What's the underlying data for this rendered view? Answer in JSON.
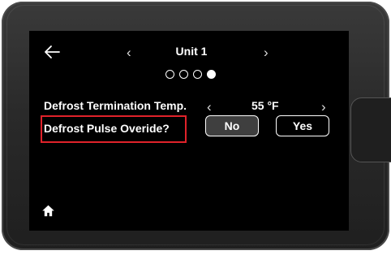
{
  "header": {
    "unit_title": "Unit 1",
    "prev_glyph": "‹",
    "next_glyph": "›",
    "page_indicator": {
      "total": 4,
      "active_index": 3
    }
  },
  "settings": {
    "defrost_termination": {
      "label": "Defrost Termination Temp.",
      "value": "55 °F",
      "decrease_glyph": "‹",
      "increase_glyph": "›"
    },
    "defrost_pulse": {
      "label": "Defrost Pulse Overide?",
      "no_label": "No",
      "yes_label": "Yes",
      "selected": "No"
    }
  },
  "icons": {
    "back": "arrow-left-icon",
    "home": "home-icon"
  },
  "colors": {
    "screen_bg": "#000000",
    "text": "#ffffff",
    "selected_button": "#3f3f3f",
    "highlight": "#e0222a",
    "bezel": "#2a2a2a"
  }
}
